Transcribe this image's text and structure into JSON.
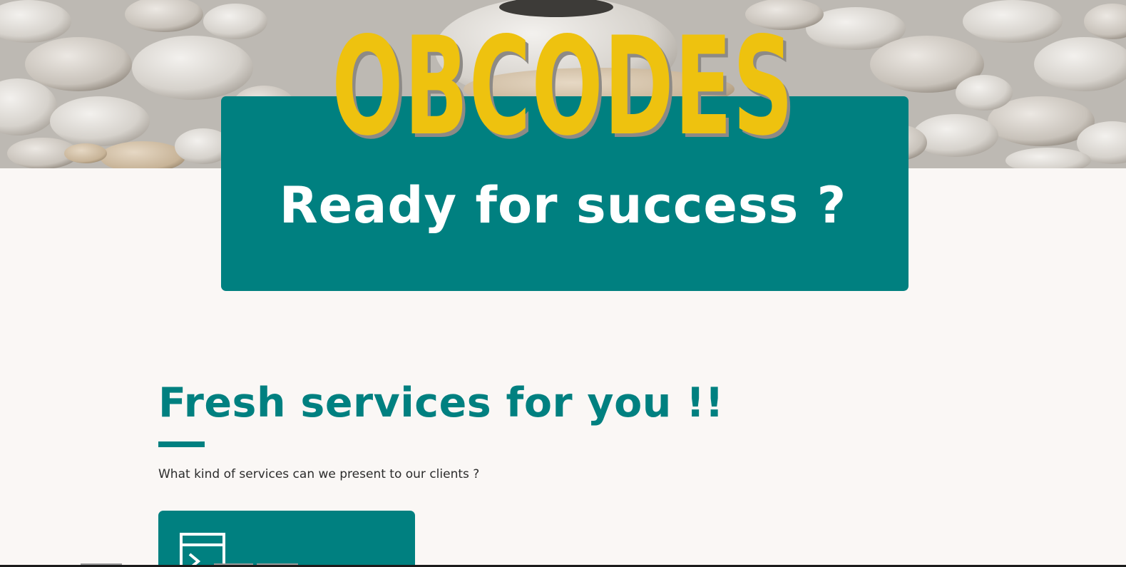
{
  "hero": {
    "brand_title": "OBCODES",
    "subtitle": "Ready for success ?"
  },
  "services": {
    "heading": "Fresh services for you !!",
    "description": "What kind of services can we present to our clients ?",
    "card_icon": "terminal-window-icon"
  },
  "colors": {
    "accent": "#008080",
    "brand_yellow": "#eec20f",
    "background": "#faf7f5"
  }
}
